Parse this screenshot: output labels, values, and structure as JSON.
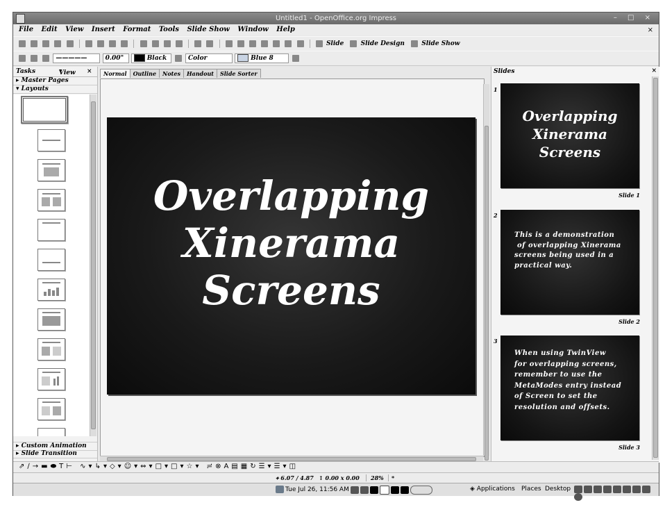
{
  "window": {
    "title": "Untitled1 - OpenOffice.org Impress",
    "controls": "– □ ×"
  },
  "menu": [
    "File",
    "Edit",
    "View",
    "Insert",
    "Format",
    "Tools",
    "Slide Show",
    "Window",
    "Help"
  ],
  "doc_close": "×",
  "toolbar": {
    "slide_label": "Slide",
    "slide_design_label": "Slide Design",
    "slide_show_label": "Slide Show"
  },
  "format_bar": {
    "line_width": "0.00\"",
    "line_color": "Black",
    "fill_type": "Color",
    "fill_color": "Blue 8",
    "colors": {
      "black": "#000000",
      "blue8": "#c9d4e4"
    }
  },
  "tasks": {
    "title": "Tasks",
    "view_label": "View",
    "sections": [
      "Master Pages",
      "Layouts",
      "Custom Animation",
      "Slide Transition"
    ]
  },
  "view_tabs": [
    "Normal",
    "Outline",
    "Notes",
    "Handout",
    "Slide Sorter"
  ],
  "main_slide": {
    "title": "Overlapping\nXinerama\nScreens"
  },
  "slides_panel": {
    "title": "Slides",
    "slides": [
      {
        "num": "1",
        "text": "Overlapping\nXinerama\nScreens",
        "label": "Slide 1"
      },
      {
        "num": "2",
        "text": "This is a demonstration\n of overlapping Xinerama\nscreens being used in a\npractical way.",
        "label": "Slide 2"
      },
      {
        "num": "3",
        "text": "When using TwinView\nfor overlapping screens,\nremember to use the\nMetaModes entry instead\nof Screen to set the\nresolution and offsets.",
        "label": "Slide 3"
      }
    ]
  },
  "status": {
    "position": "6.07 / 4.87",
    "size": "0.00 x 0.00",
    "zoom": "28%",
    "star": "*"
  },
  "panel": {
    "datetime": "Tue Jul 26, 11:56 AM",
    "menus": [
      "Applications",
      "Places",
      "Desktop"
    ]
  }
}
